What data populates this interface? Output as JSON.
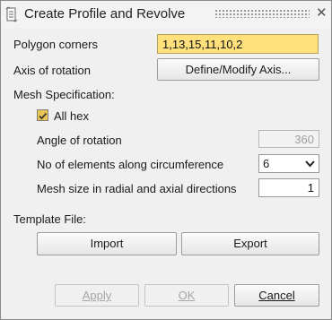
{
  "window": {
    "title": "Create Profile and Revolve",
    "close_glyph": "✕"
  },
  "polygon_corners": {
    "label": "Polygon corners",
    "value": "1,13,15,11,10,2"
  },
  "axis_of_rotation": {
    "label": "Axis of rotation",
    "button_label": "Define/Modify Axis..."
  },
  "mesh_spec": {
    "heading": "Mesh Specification:",
    "all_hex_label": "All hex",
    "all_hex_checked": true,
    "angle_label": "Angle of rotation",
    "angle_value": "360",
    "circumference_label": "No of elements along circumference",
    "circumference_value": "6",
    "mesh_size_label": "Mesh size in radial and axial directions",
    "mesh_size_value": "1"
  },
  "template_file": {
    "heading": "Template File:",
    "import_label": "Import",
    "export_label": "Export"
  },
  "footer": {
    "apply_label": "Apply",
    "ok_label": "OK",
    "cancel_label": "Cancel"
  },
  "colors": {
    "highlight_input": "#ffe07a",
    "checkbox_fill": "#e8c450",
    "dialog_bg": "#f0f0f0"
  }
}
